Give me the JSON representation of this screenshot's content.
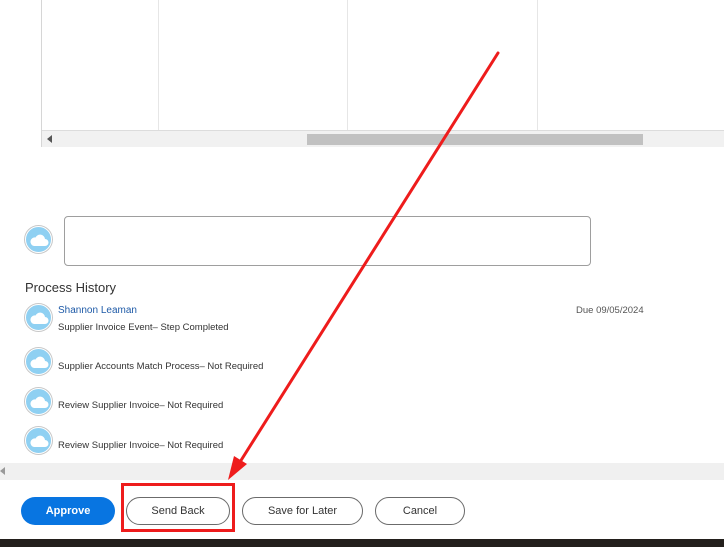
{
  "colors": {
    "primary_button": "#0875e1",
    "link": "#1e5aa7",
    "annotation_red": "#ee1c1c",
    "avatar": "#8fd0f2"
  },
  "icons": {
    "avatar": "cloud-icon",
    "scroll_left": "triangle-left-icon"
  },
  "comment": {
    "value": ""
  },
  "process_history": {
    "title": "Process History",
    "items": [
      {
        "name": "Shannon Leaman",
        "text": "Supplier Invoice Event– Step Completed",
        "due": "Due 09/05/2024"
      },
      {
        "name": "",
        "text": "Supplier Accounts Match Process– Not Required",
        "due": ""
      },
      {
        "name": "",
        "text": "Review Supplier Invoice– Not Required",
        "due": ""
      },
      {
        "name": "",
        "text": "Review Supplier Invoice– Not Required",
        "due": ""
      }
    ]
  },
  "buttons": {
    "approve": "Approve",
    "send_back": "Send Back",
    "save_for_later": "Save for Later",
    "cancel": "Cancel"
  }
}
